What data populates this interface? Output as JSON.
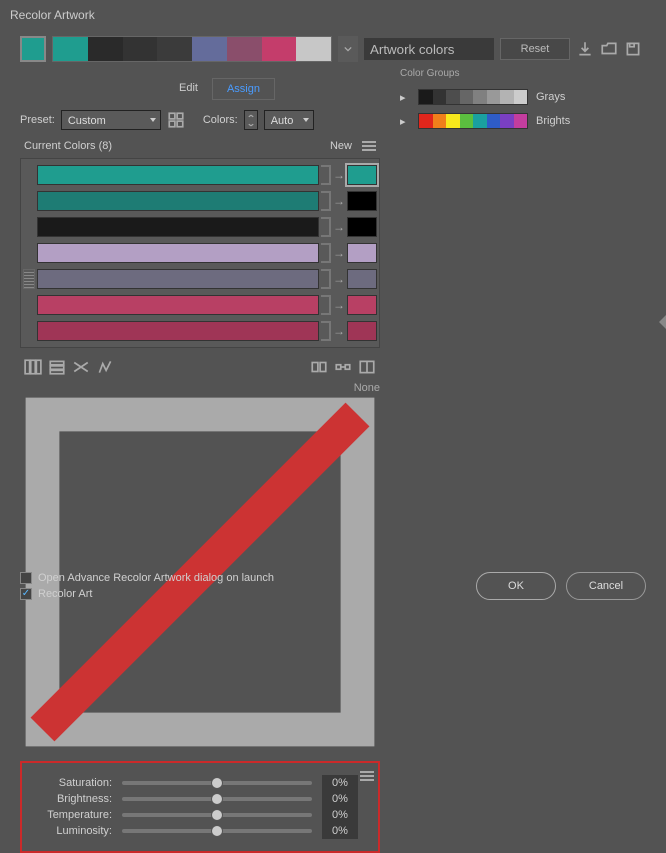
{
  "title": "Recolor Artwork",
  "top": {
    "active_color": "#1f9d8f",
    "swatch_row": [
      "#1f9d8f",
      "#2a2a2a",
      "#333333",
      "#3b3b3b",
      "#646c9b",
      "#8a4e6b",
      "#c43d6b",
      "#c7c7c7"
    ],
    "input_value": "Artwork colors",
    "reset": "Reset"
  },
  "tabs": {
    "edit": "Edit",
    "assign": "Assign"
  },
  "preset": {
    "label": "Preset:",
    "value": "Custom",
    "colors_label": "Colors:",
    "colors_value": "Auto"
  },
  "current": {
    "label": "Current Colors (8)",
    "new_label": "New"
  },
  "rows": [
    {
      "bar": "#1f9d8f",
      "new": "#1f9d8f",
      "sel": true
    },
    {
      "bar": "#1e7c74",
      "new": "#000000"
    },
    {
      "bar": "#1a1a1a",
      "new": "#000000"
    },
    {
      "bar": "#b39fc4",
      "new": "#b39fc4"
    },
    {
      "bar": "#6d6b7f",
      "new": "#6d6b7f",
      "grip": true
    },
    {
      "bar": "#b84064",
      "new": "#b84064"
    },
    {
      "bar": "#9f3556",
      "new": "#9f3556"
    }
  ],
  "none_label": "None",
  "sliders": [
    {
      "label": "Saturation:",
      "value": "0%"
    },
    {
      "label": "Brightness:",
      "value": "0%"
    },
    {
      "label": "Temperature:",
      "value": "0%"
    },
    {
      "label": "Luminosity:",
      "value": "0%"
    }
  ],
  "color_groups": {
    "title": "Color Groups",
    "groups": [
      {
        "name": "Grays",
        "swatches": [
          "#1a1a1a",
          "#333",
          "#4d4d4d",
          "#666",
          "#808080",
          "#999",
          "#b3b3b3",
          "#ccc"
        ]
      },
      {
        "name": "Brights",
        "swatches": [
          "#e0261c",
          "#f07f1b",
          "#f7e81c",
          "#5bbf3f",
          "#1aa0a0",
          "#2e5cc7",
          "#7a3fc2",
          "#c43d9e"
        ]
      }
    ]
  },
  "bottom": {
    "open_advance": "Open Advance Recolor Artwork dialog on launch",
    "recolor_art": "Recolor Art",
    "ok": "OK",
    "cancel": "Cancel"
  }
}
